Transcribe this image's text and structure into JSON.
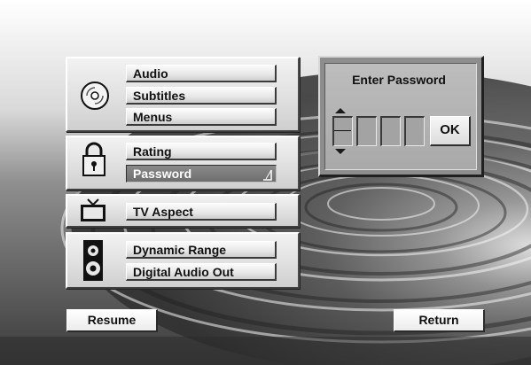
{
  "menu": {
    "audio_group": {
      "icon": "disc-icon",
      "items": [
        {
          "label": "Audio"
        },
        {
          "label": "Subtitles"
        },
        {
          "label": "Menus"
        }
      ]
    },
    "lock_group": {
      "icon": "lock-icon",
      "items": [
        {
          "label": "Rating"
        },
        {
          "label": "Password",
          "selected": true
        }
      ]
    },
    "tv_group": {
      "icon": "tv-icon",
      "items": [
        {
          "label": "TV Aspect"
        }
      ]
    },
    "speaker_group": {
      "icon": "speaker-icon",
      "items": [
        {
          "label": "Dynamic Range"
        },
        {
          "label": "Digital Audio Out"
        }
      ]
    }
  },
  "password_dialog": {
    "title": "Enter Password",
    "digits": [
      "",
      "",
      "",
      ""
    ],
    "ok_label": "OK",
    "spinner_icons": [
      "arrow-up-icon",
      "arrow-down-icon"
    ]
  },
  "footer": {
    "resume_label": "Resume",
    "return_label": "Return"
  },
  "colors": {
    "panel": "#e0e0e0",
    "selected_button": "#7a7a7a",
    "dialog": "#8d8d8d"
  }
}
